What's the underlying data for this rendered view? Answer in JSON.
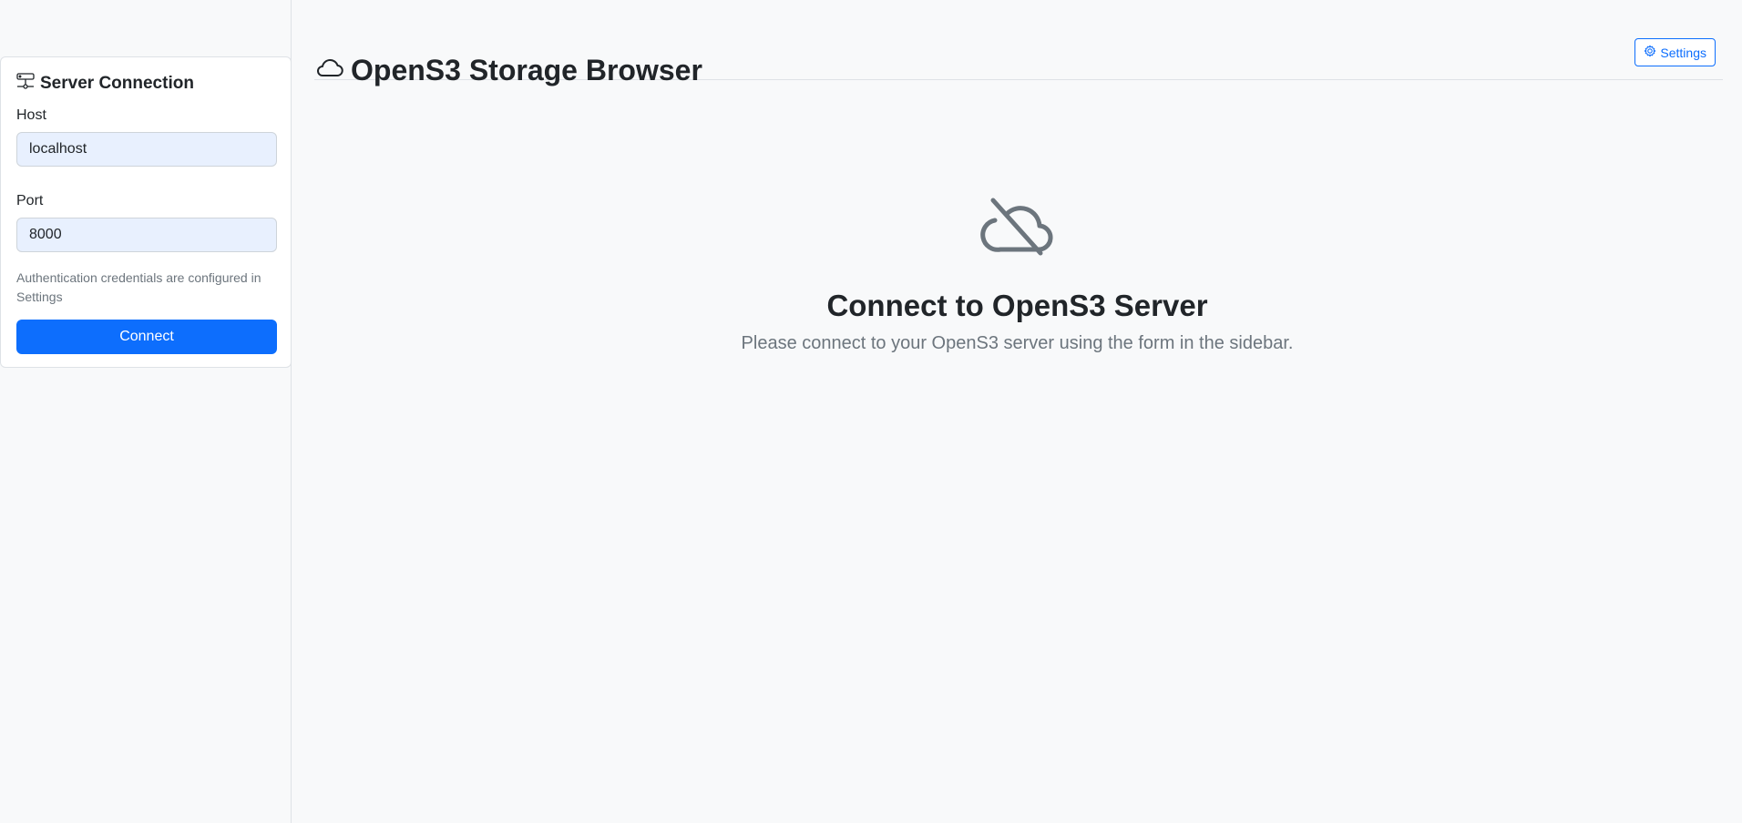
{
  "sidebar": {
    "card_title": "Server Connection",
    "title_icon": "hdd-network-icon",
    "host_label": "Host",
    "host_value": "localhost",
    "port_label": "Port",
    "port_value": "8000",
    "help_text": "Authentication credentials are configured in Settings",
    "connect_label": "Connect"
  },
  "header": {
    "title": "OpenS3 Storage Browser",
    "title_icon": "cloud-icon",
    "settings_label": "Settings",
    "settings_icon": "gear-icon"
  },
  "empty_state": {
    "icon": "cloud-slash-icon",
    "title": "Connect to OpenS3 Server",
    "subtitle": "Please connect to your OpenS3 server using the form in the sidebar."
  },
  "colors": {
    "primary": "#0d6efd",
    "background": "#f8f9fa",
    "input_fill": "#e8f0fe",
    "muted": "#6c757d"
  }
}
